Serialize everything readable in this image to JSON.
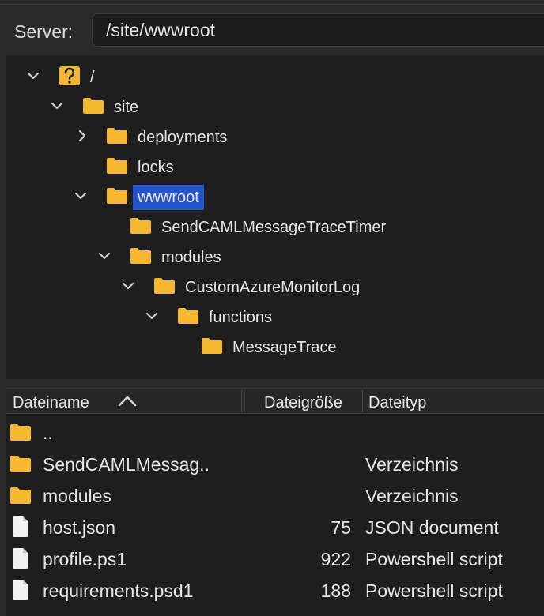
{
  "server": {
    "label": "Server:",
    "path": "/site/wwwroot"
  },
  "tree": [
    {
      "label": "/",
      "icon": "unknown-folder-icon",
      "expanded": true
    },
    {
      "label": "site",
      "icon": "folder-icon",
      "expanded": true
    },
    {
      "label": "deployments",
      "icon": "folder-icon",
      "expanded": false
    },
    {
      "label": "locks",
      "icon": "folder-icon"
    },
    {
      "label": "wwwroot",
      "icon": "folder-icon",
      "expanded": true,
      "selected": true
    },
    {
      "label": "SendCAMLMessageTraceTimer",
      "icon": "folder-icon"
    },
    {
      "label": "modules",
      "icon": "folder-icon",
      "expanded": true
    },
    {
      "label": "CustomAzureMonitorLog",
      "icon": "folder-icon",
      "expanded": true
    },
    {
      "label": "functions",
      "icon": "folder-icon",
      "expanded": true
    },
    {
      "label": "MessageTrace",
      "icon": "folder-icon"
    }
  ],
  "columns": {
    "name": "Dateiname",
    "size": "Dateigröße",
    "type": "Dateityp"
  },
  "files": [
    {
      "name": "..",
      "size": "",
      "type": "",
      "icon": "folder-icon"
    },
    {
      "name": "SendCAMLMessag..",
      "size": "",
      "type": "Verzeichnis",
      "icon": "folder-icon"
    },
    {
      "name": "modules",
      "size": "",
      "type": "Verzeichnis",
      "icon": "folder-icon"
    },
    {
      "name": "host.json",
      "size": "75",
      "type": "JSON document",
      "icon": "file-icon"
    },
    {
      "name": "profile.ps1",
      "size": "922",
      "type": "Powershell script",
      "icon": "file-icon"
    },
    {
      "name": "requirements.psd1",
      "size": "188",
      "type": "Powershell script",
      "icon": "file-icon"
    }
  ],
  "colors": {
    "folder": "#f5b82e",
    "selection": "#2553c9",
    "background": "#1e1e1e"
  }
}
